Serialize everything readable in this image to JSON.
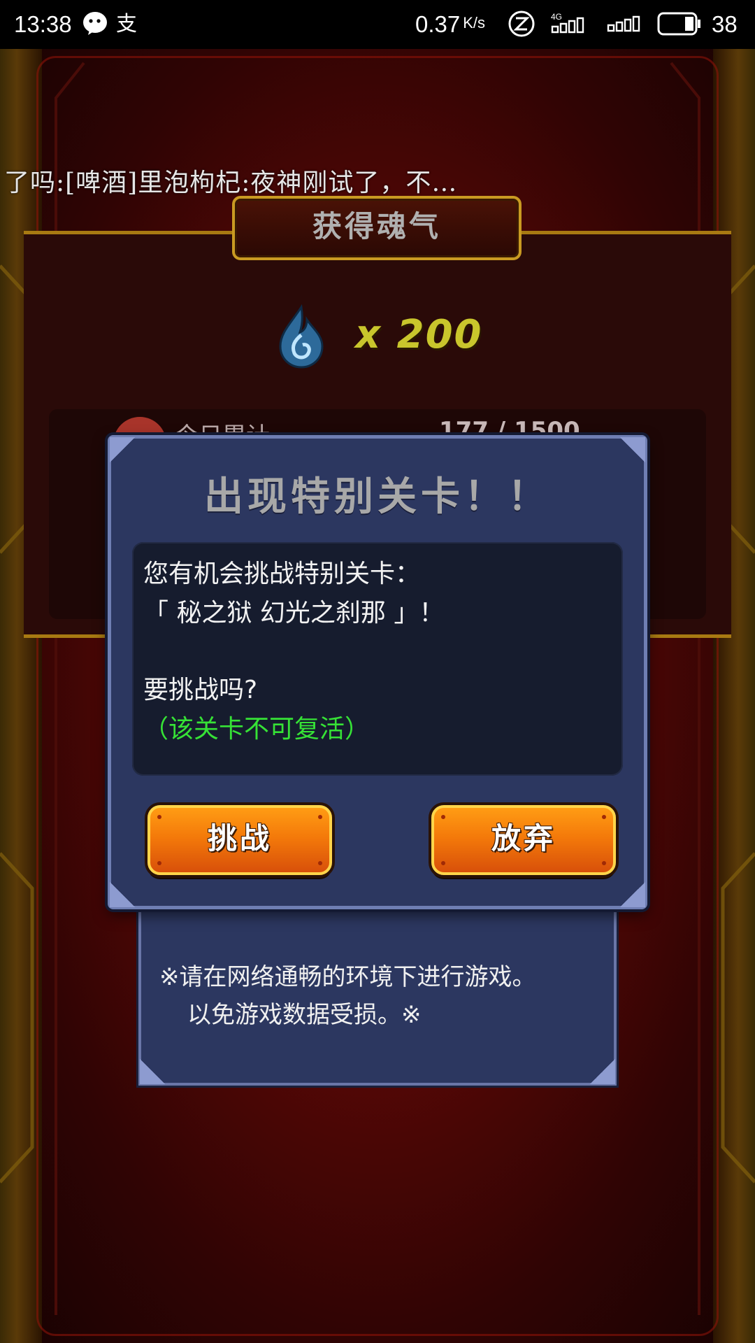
{
  "status_bar": {
    "time": "13:38",
    "pay_glyph": "支",
    "net_speed": "0.37",
    "net_speed_unit": "K/s",
    "network": "4G",
    "battery": "38",
    "icons": [
      "wechat-icon",
      "z-icon",
      "4g-signal-icon",
      "wifi-icon",
      "battery-icon"
    ]
  },
  "ticker": {
    "text": "了吗:[啤酒]里泡枸杞:夜神刚试了，不…"
  },
  "result": {
    "title": "获得魂气",
    "soul_amount": "x 200",
    "daily_label": "今日累计",
    "daily_value": "177 / 1500"
  },
  "notice": {
    "line1": "※请在网络通畅的环境下进行游戏。",
    "line2": "以免游戏数据受损。※"
  },
  "dialog": {
    "title": "出现特别关卡！！",
    "line1": "您有机会挑战特别关卡：",
    "line2": "「 秘之狱 幻光之刹那 」！",
    "line3": "要挑战吗?",
    "warning": "（该关卡不可复活）",
    "challenge_label": "挑战",
    "abandon_label": "放弃"
  },
  "colors": {
    "dialog_bg": "#2c3760",
    "warning_text": "#36e236",
    "button_orange": "#f47a0a",
    "soul_count": "#c9c62c"
  }
}
